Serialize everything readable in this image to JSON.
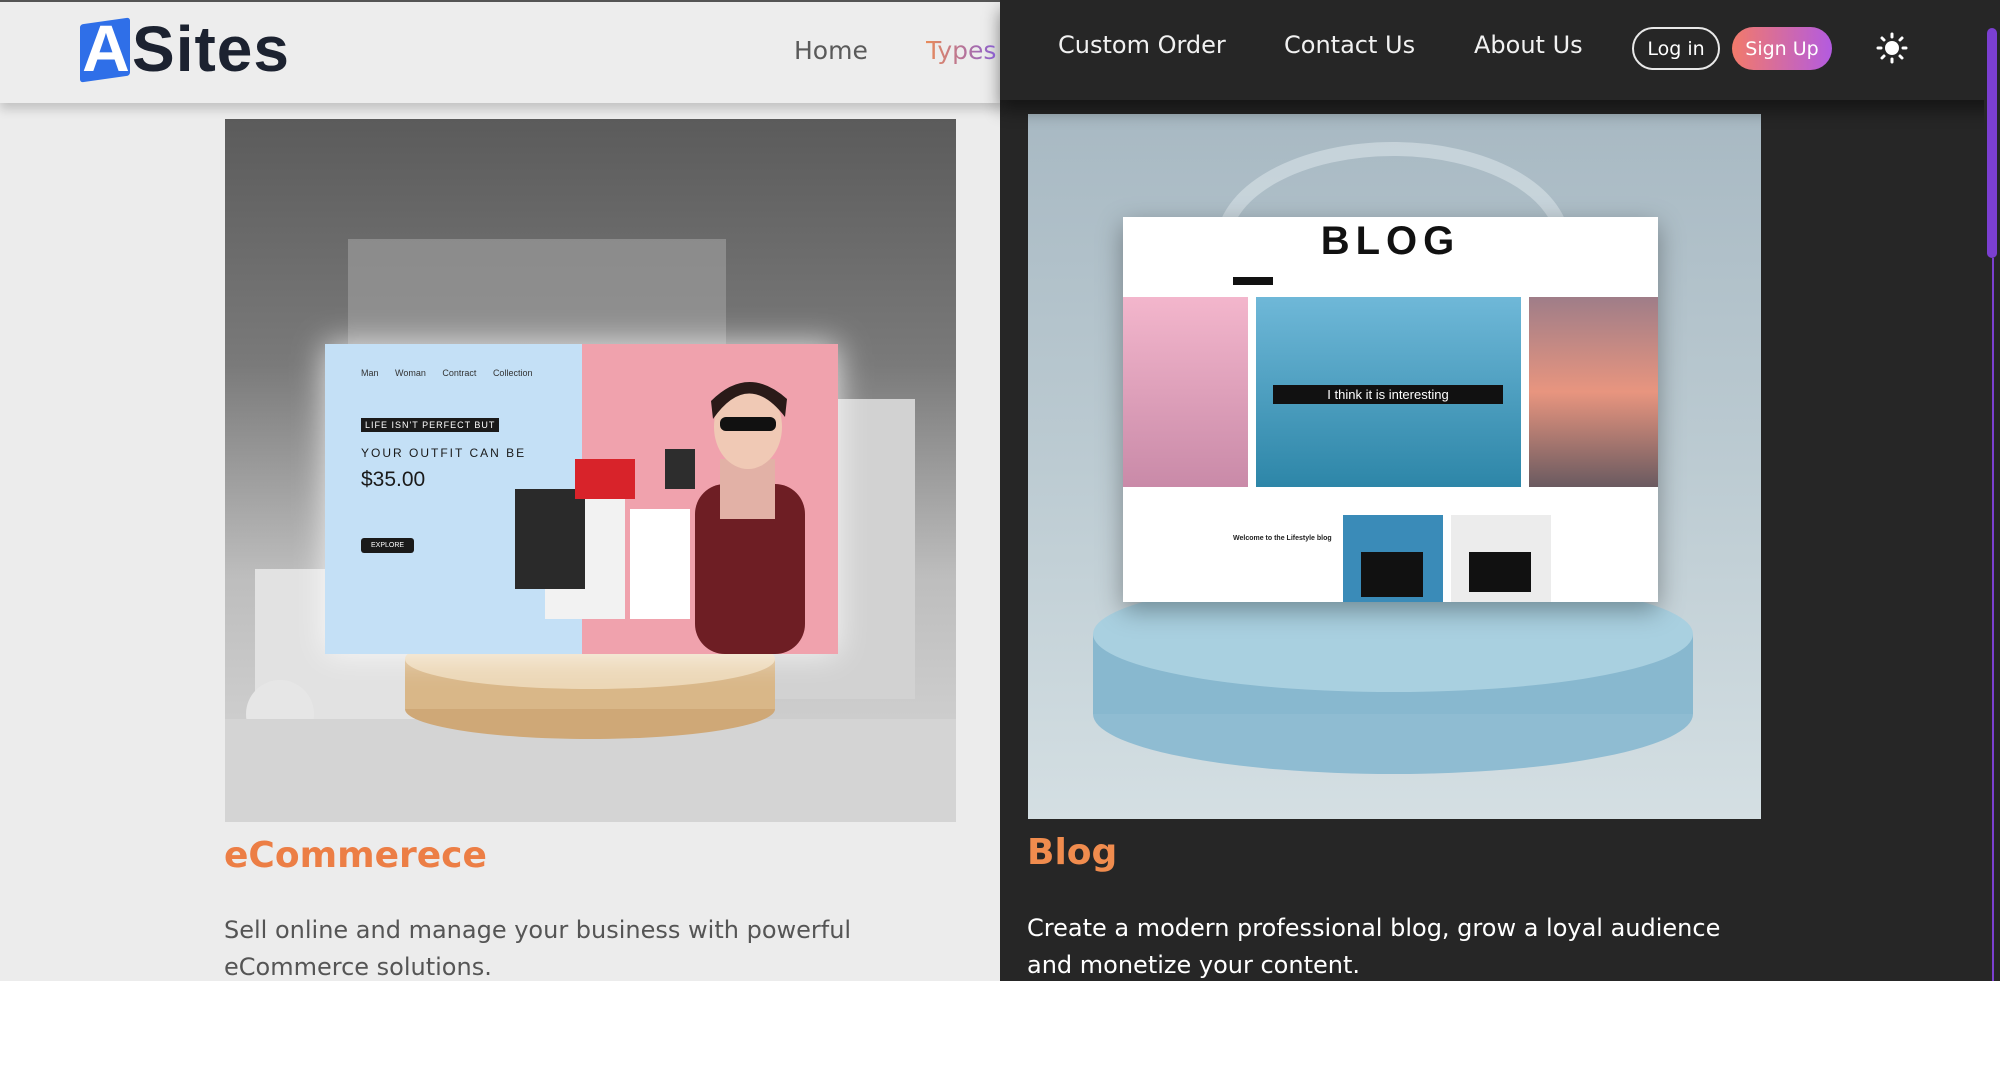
{
  "brand": {
    "logo_letter": "A",
    "logo_text": "Sites",
    "accent": "#2f6fe8"
  },
  "nav": {
    "home": "Home",
    "types": "Types",
    "custom_order": "Custom Order",
    "contact_us": "Contact Us",
    "about_us": "About Us",
    "login": "Log in",
    "signup": "Sign Up",
    "theme_icon": "sun-icon"
  },
  "cards": [
    {
      "title": "eCommerece",
      "description": "Sell online and manage your business with powerful eCommerce solutions.",
      "mockup": {
        "menu": [
          "Man",
          "Woman",
          "Contract",
          "Collection"
        ],
        "tagline": "LIFE ISN'T PERFECT BUT",
        "headline": "YOUR OUTFIT CAN BE",
        "price": "$35.00",
        "button": "EXPLORE"
      }
    },
    {
      "title": "Blog",
      "description": "Create a modern professional blog, grow a loyal audience and monetize your content.",
      "mockup": {
        "heading": "BLOG",
        "caption": "I think it is interesting",
        "welcome": "Welcome to the Lifestyle blog"
      }
    }
  ],
  "colors": {
    "title_accent": "#ec7e45",
    "scroll_accent": "#7b3fd1",
    "signup_start": "#f27a6a",
    "signup_end": "#b35be0"
  }
}
